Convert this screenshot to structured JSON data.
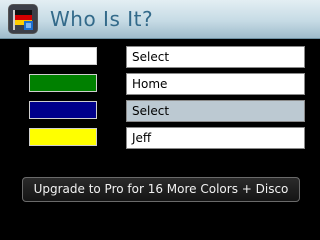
{
  "header": {
    "title": "Who Is It?",
    "icon": "app-flag-icon"
  },
  "rows": [
    {
      "color": "#ffffff",
      "value": "Select"
    },
    {
      "color": "#008000",
      "value": "Home"
    },
    {
      "color": "#00008b",
      "value": "Select"
    },
    {
      "color": "#ffff00",
      "value": "Jeff"
    }
  ],
  "upgrade_button": {
    "label": "Upgrade to Pro for 16 More Colors + Disco"
  }
}
